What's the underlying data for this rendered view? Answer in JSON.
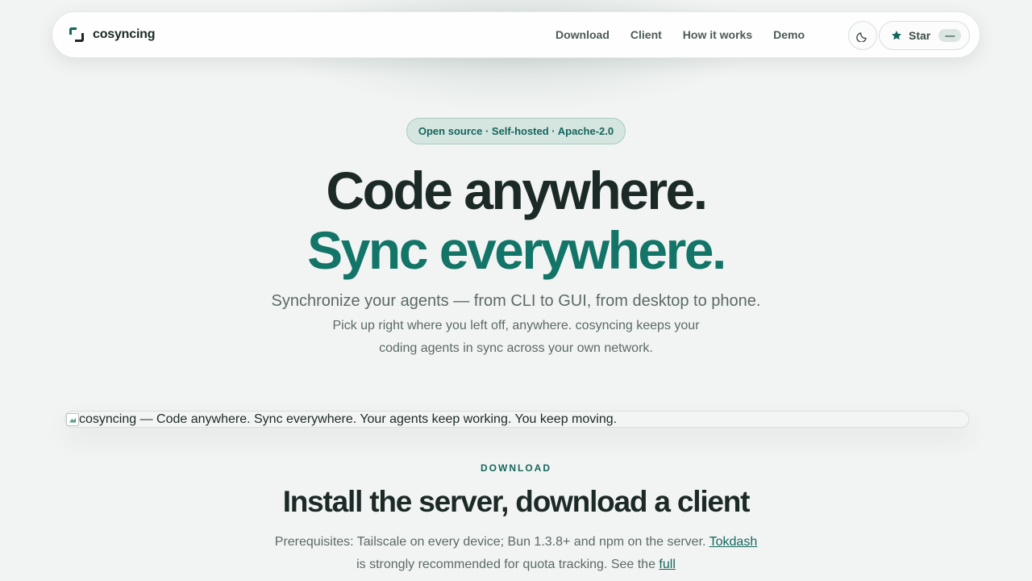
{
  "nav": {
    "brand": "cosyncing",
    "links": [
      "Download",
      "Client",
      "How it works",
      "Demo"
    ],
    "theme_icon": "moon-icon",
    "star_icon": "star-icon",
    "star_label": "Star",
    "star_count": "—"
  },
  "hero": {
    "badge": "Open source · Self-hosted · Apache-2.0",
    "line1": "Code anywhere.",
    "line2": "Sync everywhere.",
    "subtitle": "Synchronize your agents — from CLI to GUI, from desktop to phone.",
    "description": "Pick up right where you left off, anywhere. cosyncing keeps your coding agents in sync across your own network."
  },
  "banner": {
    "alt_text": "cosyncing — Code anywhere. Sync everywhere. Your agents keep working. You keep moving."
  },
  "download": {
    "label": "DOWNLOAD",
    "title": "Install the server, download a client",
    "prereq_line1": "Prerequisites: Tailscale on every device; Bun 1.3.8+ and npm on the server.",
    "tokdash_link": "Tokdash",
    "prereq_line2": " is strongly recommended for quota tracking. See the ",
    "full_link": "full"
  },
  "colors": {
    "accent": "#137568",
    "background": "#f2f4f3",
    "text": "#1c2a27"
  }
}
